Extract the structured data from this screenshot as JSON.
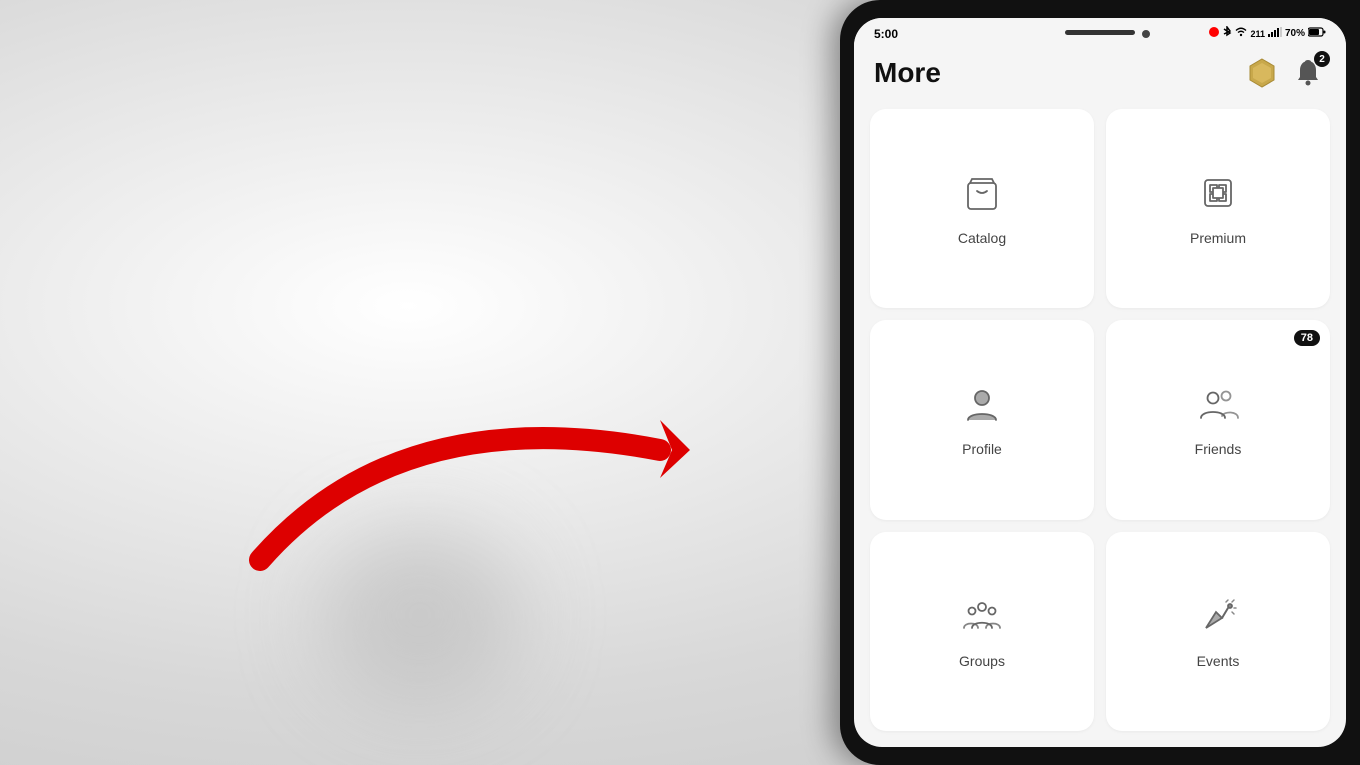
{
  "background": {
    "color": "#e0e0e0"
  },
  "phone": {
    "status_bar": {
      "time": "5:00",
      "battery": "70%",
      "signal_icons": "🔵 📶 70%"
    },
    "header": {
      "title": "More",
      "coin_badge": "",
      "bell_badge": "2"
    },
    "grid": [
      {
        "id": "catalog",
        "label": "Catalog",
        "icon": "bag",
        "badge": null
      },
      {
        "id": "premium",
        "label": "Premium",
        "icon": "premium",
        "badge": null
      },
      {
        "id": "profile",
        "label": "Profile",
        "icon": "person",
        "badge": null
      },
      {
        "id": "friends",
        "label": "Friends",
        "icon": "friends",
        "badge": "78"
      },
      {
        "id": "groups",
        "label": "Groups",
        "icon": "groups",
        "badge": null
      },
      {
        "id": "events",
        "label": "Events",
        "icon": "events",
        "badge": null
      }
    ]
  },
  "arrow": {
    "color": "#e00000"
  }
}
